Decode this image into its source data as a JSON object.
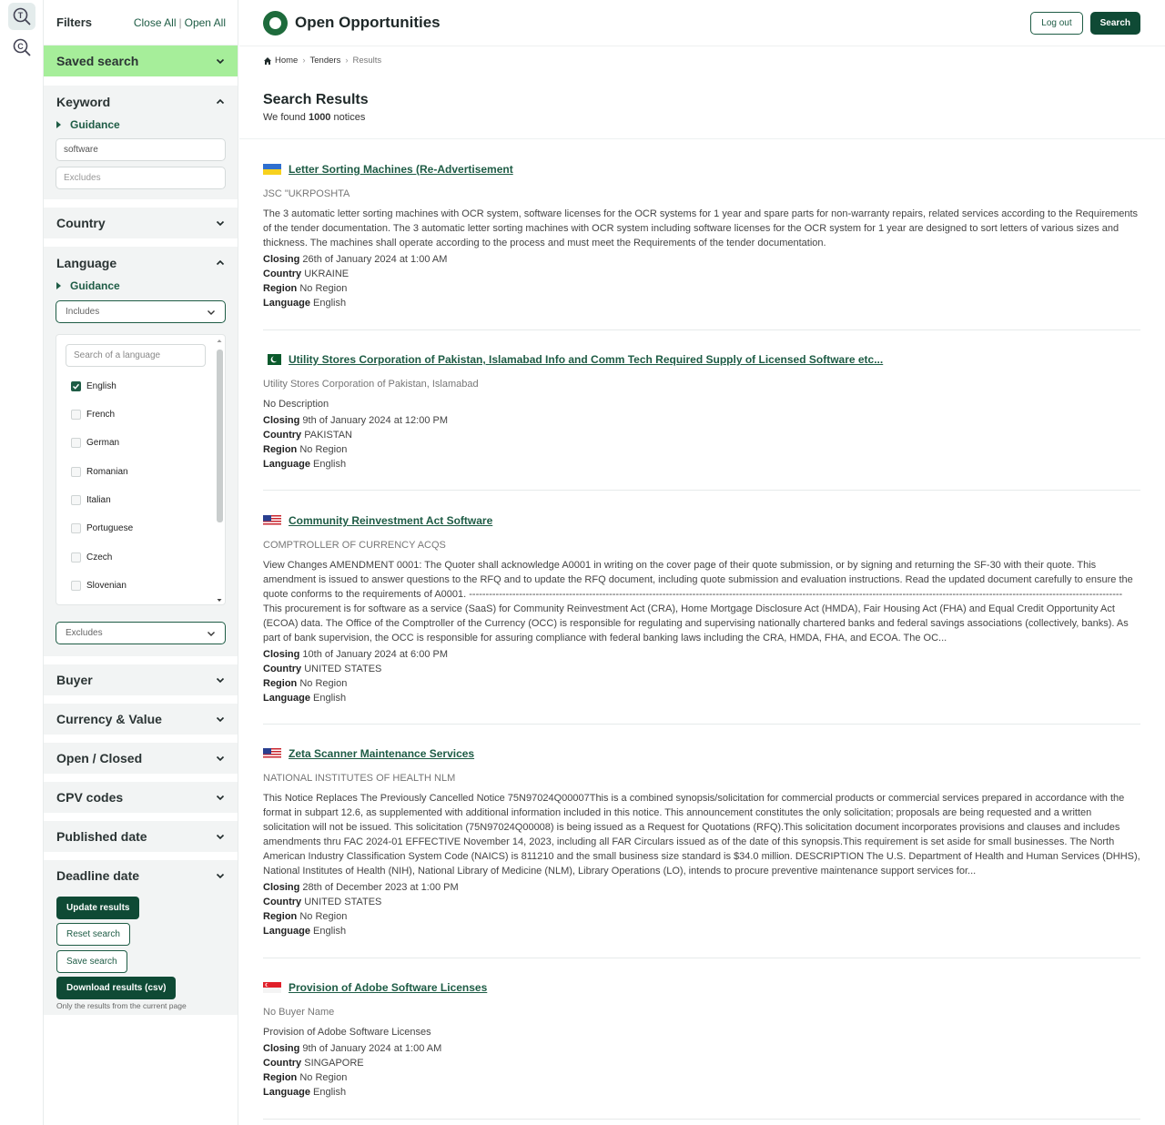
{
  "filters": {
    "title": "Filters",
    "close_all": "Close All",
    "open_all": "Open All",
    "saved_search": "Saved search",
    "keyword": {
      "title": "Keyword",
      "guidance": "Guidance",
      "includes_value": "software",
      "excludes_placeholder": "Excludes"
    },
    "country": "Country",
    "language": {
      "title": "Language",
      "guidance": "Guidance",
      "includes_select": "Includes",
      "search_placeholder": "Search of a language",
      "options": [
        {
          "label": "English",
          "checked": true
        },
        {
          "label": "French",
          "checked": false
        },
        {
          "label": "German",
          "checked": false
        },
        {
          "label": "Romanian",
          "checked": false
        },
        {
          "label": "Italian",
          "checked": false
        },
        {
          "label": "Portuguese",
          "checked": false
        },
        {
          "label": "Czech",
          "checked": false
        },
        {
          "label": "Slovenian",
          "checked": false
        }
      ],
      "excludes_select": "Excludes"
    },
    "buyer": "Buyer",
    "currency_value": "Currency & Value",
    "open_closed": "Open / Closed",
    "cpv_codes": "CPV codes",
    "published_date": "Published date",
    "deadline_date": "Deadline date",
    "update_results": "Update results",
    "reset_search": "Reset search",
    "save_search": "Save search",
    "download_results": "Download results (csv)",
    "download_note": "Only the results from the current page"
  },
  "header": {
    "brand": "Open Opportunities",
    "logout": "Log out",
    "search": "Search"
  },
  "breadcrumb": [
    "Home",
    "Tenders",
    "Results"
  ],
  "results": {
    "title": "Search Results",
    "prefix": "We found",
    "count": "1000",
    "suffix": "notices"
  },
  "labels": {
    "closing": "Closing",
    "country": "Country",
    "region": "Region",
    "language": "Language"
  },
  "notices": [
    {
      "flag": "ukraine",
      "title": "Letter Sorting Machines (Re-Advertisement",
      "buyer": "JSC \"UKRPOSHTA",
      "description": "The 3 automatic letter sorting machines with OCR system, software licenses for the OCR systems for 1 year and spare parts for non-warranty repairs, related services according to the Requirements of the tender documentation. The 3 automatic letter sorting machines with OCR system including software licenses for the OCR system for 1 year are designed to sort letters of various sizes and thickness. The machines shall operate according to the process and must meet the Requirements of the tender documentation.",
      "closing": "26th of January 2024 at 1:00 AM",
      "country": "UKRAINE",
      "region": "No Region",
      "language": "English"
    },
    {
      "flag": "pakistan",
      "title": "Utility Stores Corporation of Pakistan, Islamabad Info and Comm Tech Required Supply of Licensed Software etc...",
      "buyer": "Utility Stores Corporation of Pakistan, Islamabad",
      "description": "No Description",
      "closing": "9th of January 2024 at 12:00 PM",
      "country": "PAKISTAN",
      "region": "No Region",
      "language": "English"
    },
    {
      "flag": "usa",
      "title": "Community Reinvestment Act Software",
      "buyer": "COMPTROLLER OF CURRENCY ACQS",
      "description": "View Changes AMENDMENT 0001: The Quoter shall acknowledge A0001 in writing on the cover page of their quote submission, or by signing and returning the SF-30 with their quote. This amendment is issued to answer questions to the RFQ and to update the RFQ document, including quote submission and evaluation instructions.  Read the updated document carefully to ensure the quote conforms to the requirements of A0001. ---------------------------------------------------------------------------------------------------------------------------------------------------------------------------------------------------- This procurement is for software as a service (SaaS) for Community Reinvestment Act (CRA), Home Mortgage Disclosure Act (HMDA), Fair Housing Act (FHA) and Equal Credit Opportunity Act (ECOA) data.  The Office of the Comptroller of the Currency (OCC) is responsible for regulating and supervising nationally chartered banks and federal savings associations (collectively, banks).  As part of bank supervision, the OCC is responsible for assuring compliance with federal banking laws including the CRA, HMDA, FHA, and ECOA.  The OC...",
      "closing": "10th of January 2024 at 6:00 PM",
      "country": "UNITED STATES",
      "region": "No Region",
      "language": "English"
    },
    {
      "flag": "usa",
      "title": "Zeta Scanner Maintenance Services",
      "buyer": "NATIONAL INSTITUTES OF HEALTH NLM",
      "description": "This Notice Replaces The Previously Cancelled Notice 75N97024Q00007This is a combined synopsis/solicitation for commercial products or commercial services prepared in accordance with the format in subpart 12.6, as supplemented with additional information included in this notice. This announcement constitutes the only solicitation; proposals are being requested and a written solicitation will not be issued. This solicitation (75N97024Q00008) is being issued as a Request for Quotations (RFQ).This solicitation document incorporates provisions and clauses and includes amendments thru FAC 2024-01 EFFECTIVE November 14, 2023, including all FAR Circulars issued as of the date of this synopsis.This requirement is set aside for small businesses. The North American Industry Classification System Code (NAICS) is 811210 and the small business size standard is $34.0 million. DESCRIPTION The U.S. Department of Health and Human Services (DHHS), National Institutes of Health (NIH), National Library of Medicine (NLM), Library Operations (LO), intends to procure preventive maintenance support services for...",
      "closing": "28th of December 2023 at 1:00 PM",
      "country": "UNITED STATES",
      "region": "No Region",
      "language": "English"
    },
    {
      "flag": "singapore",
      "title": "Provision of Adobe Software Licenses",
      "buyer": "No Buyer Name",
      "description": "Provision of Adobe Software Licenses",
      "closing": "9th of January 2024 at 1:00 AM",
      "country": "SINGAPORE",
      "region": "No Region",
      "language": "English"
    }
  ]
}
